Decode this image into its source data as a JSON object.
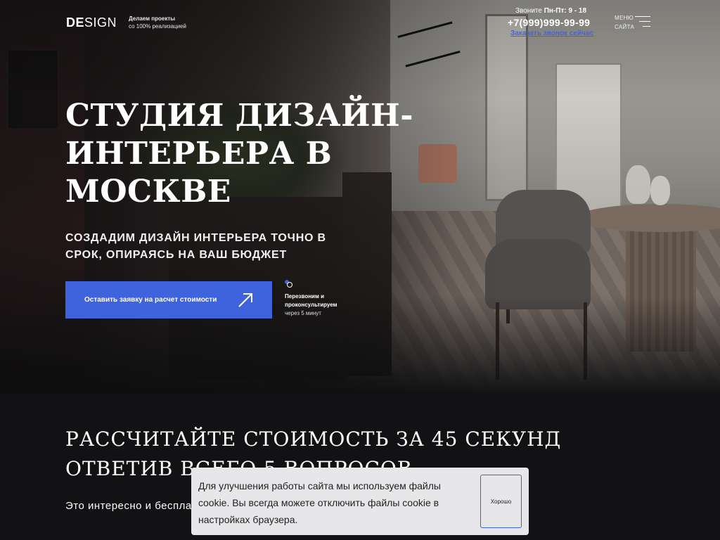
{
  "header": {
    "logo_bold": "DE",
    "logo_rest": "SIGN",
    "tagline_line1": "Делаем проекты",
    "tagline_line2": "со 100% реализацией",
    "hours_label": "Звоните",
    "hours_value": "Пн-Пт: 9 - 18",
    "phone": "+7(999)999-99-99",
    "callback_link": "Заказать звонок сейчас",
    "menu_line1": "МЕНЮ",
    "menu_line2": "САЙТА",
    "menu_icon": "hamburger-icon"
  },
  "hero": {
    "title": "Студия дизайн-интерьера в Москве",
    "subtitle": "Создадим дизайн интерьера точно в срок, опираясь на ваш бюджет",
    "cta_label": "Оставить заявку на расчет стоимости",
    "cta_icon": "arrow-up-right-icon",
    "callback_icon": "phone-icon",
    "callback_line1": "Перезвоним и",
    "callback_line2": "проконсультируем",
    "callback_line3": "через 5 минут"
  },
  "calculator": {
    "title": "Рассчитайте стоимость за 45 секунд ответив всего 5 вопросов",
    "text": "Это интересно и бесплатно"
  },
  "cookie": {
    "text": "Для улучшения работы сайта мы используем файлы cookie. Вы всегда можете отключить файлы cookie в настройках браузера.",
    "button_label": "Хорошо"
  },
  "colors": {
    "accent": "#3f63dd",
    "page_background": "#121214",
    "cookie_background": "#e7e7ea"
  }
}
